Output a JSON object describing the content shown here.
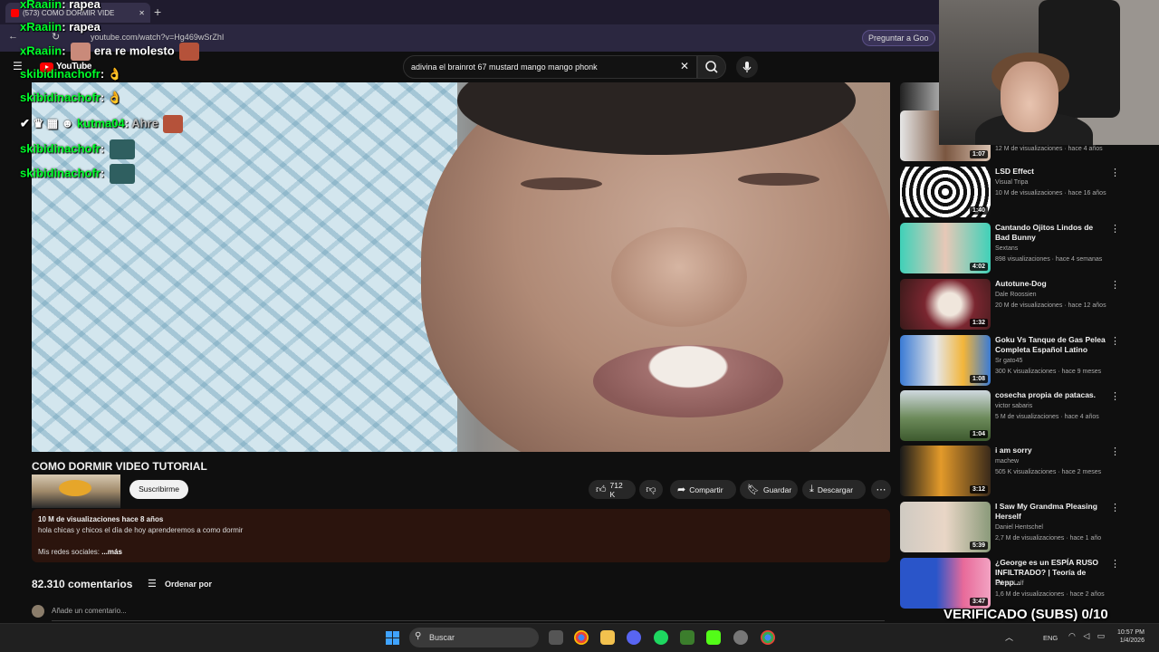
{
  "browser": {
    "tab_title": "(573) COMO DORMIR VIDE",
    "url": "youtube.com/watch?v=Hg469wSrZhI",
    "ask_google": "Preguntar a Goo"
  },
  "youtube": {
    "logo_text": "YouTube",
    "search_query": "adivina el brainrot 67 mustard mango mango phonk"
  },
  "chat": [
    {
      "user": "xRaaiin",
      "msg": "rapea"
    },
    {
      "user": "xRaaiin",
      "msg": "rapea"
    },
    {
      "user": "xRaaiin",
      "msg": "era re molesto"
    },
    {
      "user": "skibidinachofr",
      "msg": ""
    },
    {
      "user": "skibidinachofr",
      "msg": ""
    },
    {
      "user": "kutma04",
      "msg": "Ahre"
    },
    {
      "user": "skibidinachofr",
      "msg": ""
    },
    {
      "user": "skibidinachofr",
      "msg": ""
    }
  ],
  "video": {
    "title": "COMO DORMIR VIDEO TUTORIAL",
    "subscribe_label": "Suscribirme",
    "likes": "712 K",
    "share_label": "Compartir",
    "save_label": "Guardar",
    "download_label": "Descargar",
    "meta": "10 M de visualizaciones  hace 8 años",
    "description": "hola chicas y chicos el día de hoy aprenderemos a como dormir",
    "social": "Mis redes sociales: ",
    "more_label": "...más"
  },
  "comments": {
    "count": "82.310 comentarios",
    "sort_label": "Ordenar por",
    "add_placeholder": "Añade un comentario..."
  },
  "recommendations": {
    "top_meta": "12 M de visualizaciones · hace 4 años",
    "items": [
      {
        "title": "LSD Effect",
        "channel": "Visual Tripa",
        "meta": "10 M de visualizaciones · hace 16 años",
        "duration": "1:40"
      },
      {
        "title": "Cantando Ojitos Lindos de Bad Bunny",
        "channel": "Sextans",
        "meta": "898 visualizaciones · hace 4 semanas",
        "duration": "4:02"
      },
      {
        "title": "Autotune-Dog",
        "channel": "Dale Roossien",
        "meta": "20 M de visualizaciones · hace 12 años",
        "duration": "1:32"
      },
      {
        "title": "Goku Vs Tanque de Gas Pelea Completa Español Latino",
        "channel": "Sr gato45",
        "meta": "300 K visualizaciones · hace 9 meses",
        "duration": "1:08"
      },
      {
        "title": "cosecha propia de patacas.",
        "channel": "victor sabaris",
        "meta": "5 M de visualizaciones · hace 4 años",
        "duration": "1:04"
      },
      {
        "title": "i am sorry",
        "channel": "machew",
        "meta": "505 K visualizaciones · hace 2 meses",
        "duration": "3:12"
      },
      {
        "title": "I Saw My Grandma Pleasing Herself",
        "channel": "Daniel Hentschel",
        "meta": "2,7 M de visualizaciones · hace 1 año",
        "duration": "5:39"
      },
      {
        "title": "¿George es un ESPÍA RUSO INFILTRADO? | Teoría de Pepp...",
        "channel": "Edrez Lalf",
        "meta": "1,6 M de visualizaciones · hace 2 años",
        "duration": "3:47"
      }
    ],
    "first_duration": "1:07"
  },
  "overlay": {
    "subs_text": "VERIFICADO (SUBS) 0/10"
  },
  "taskbar": {
    "search_label": "Buscar",
    "language": "ENG",
    "time": "10:57 PM",
    "date": "1/4/2026"
  },
  "colors": {
    "chat_user": "#00ff2a",
    "brand_red": "#ff0000",
    "description_bg": "#2b140d"
  }
}
